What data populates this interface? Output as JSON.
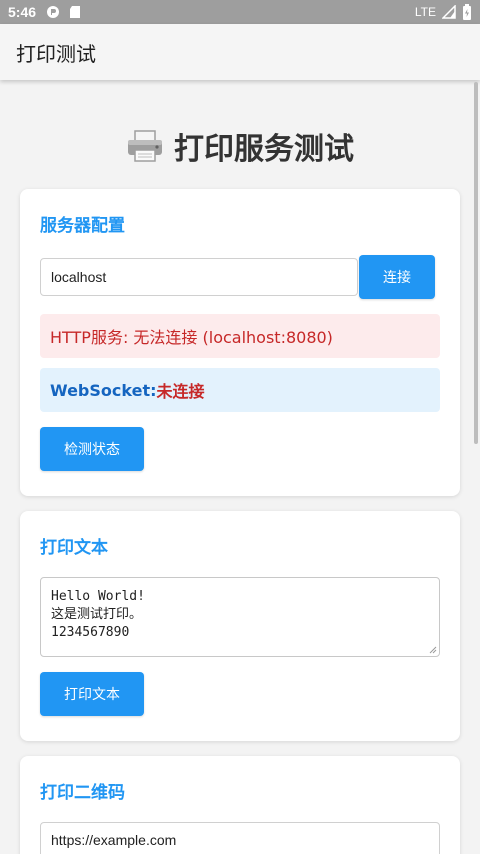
{
  "status_bar": {
    "time": "5:46",
    "network": "LTE"
  },
  "app_bar": {
    "title": "打印测试"
  },
  "page": {
    "title": "打印服务测试"
  },
  "server_config": {
    "title": "服务器配置",
    "host_value": "localhost",
    "connect_label": "连接",
    "http_status": "HTTP服务: 无法连接 (localhost:8080)",
    "ws_label": "WebSocket: ",
    "ws_state": "未连接",
    "check_label": "检测状态"
  },
  "print_text": {
    "title": "打印文本",
    "lines": [
      "Hello World!",
      "这是测试打印。",
      "1234567890"
    ],
    "print_label": "打印文本"
  },
  "print_qr": {
    "title": "打印二维码",
    "url_value": "https://example.com"
  },
  "colors": {
    "accent": "#2196f3",
    "error": "#c62828",
    "info_bg": "#e3f2fd",
    "error_bg": "#fdebec"
  }
}
